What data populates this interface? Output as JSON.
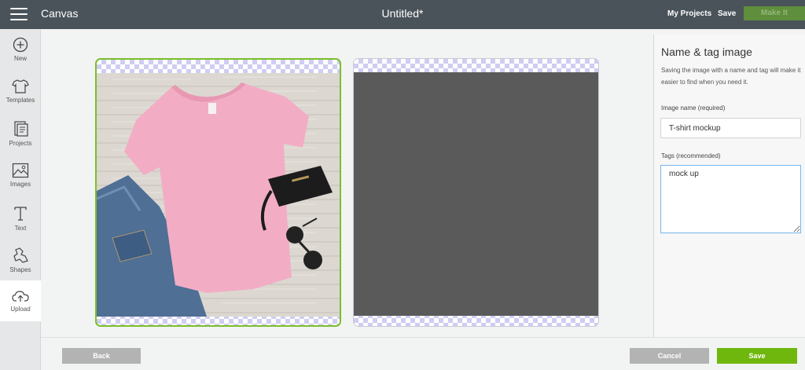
{
  "header": {
    "app_name": "Canvas",
    "doc_title": "Untitled*",
    "my_projects": "My Projects",
    "save": "Save",
    "make_it": "Make It"
  },
  "sidebar": {
    "items": [
      {
        "label": "New",
        "icon": "plus-circle-icon"
      },
      {
        "label": "Templates",
        "icon": "tshirt-icon"
      },
      {
        "label": "Projects",
        "icon": "projects-icon"
      },
      {
        "label": "Images",
        "icon": "image-icon"
      },
      {
        "label": "Text",
        "icon": "text-icon"
      },
      {
        "label": "Shapes",
        "icon": "shapes-icon"
      },
      {
        "label": "Upload",
        "icon": "cloud-upload-icon"
      }
    ],
    "active_item": "Upload"
  },
  "panel": {
    "title": "Name & tag image",
    "description": "Saving the image with a name and tag will make it easier to find when you need it.",
    "name_label": "Image name (required)",
    "name_value": "T-shirt mockup",
    "tags_label": "Tags (recommended)",
    "tags_value": "mock up"
  },
  "footer": {
    "back": "Back",
    "cancel": "Cancel",
    "save": "Save"
  },
  "colors": {
    "topbar": "#4a535a",
    "accent_green": "#6fb70d",
    "selected_border": "#79bf2b",
    "checker": "#cfcdf2"
  }
}
